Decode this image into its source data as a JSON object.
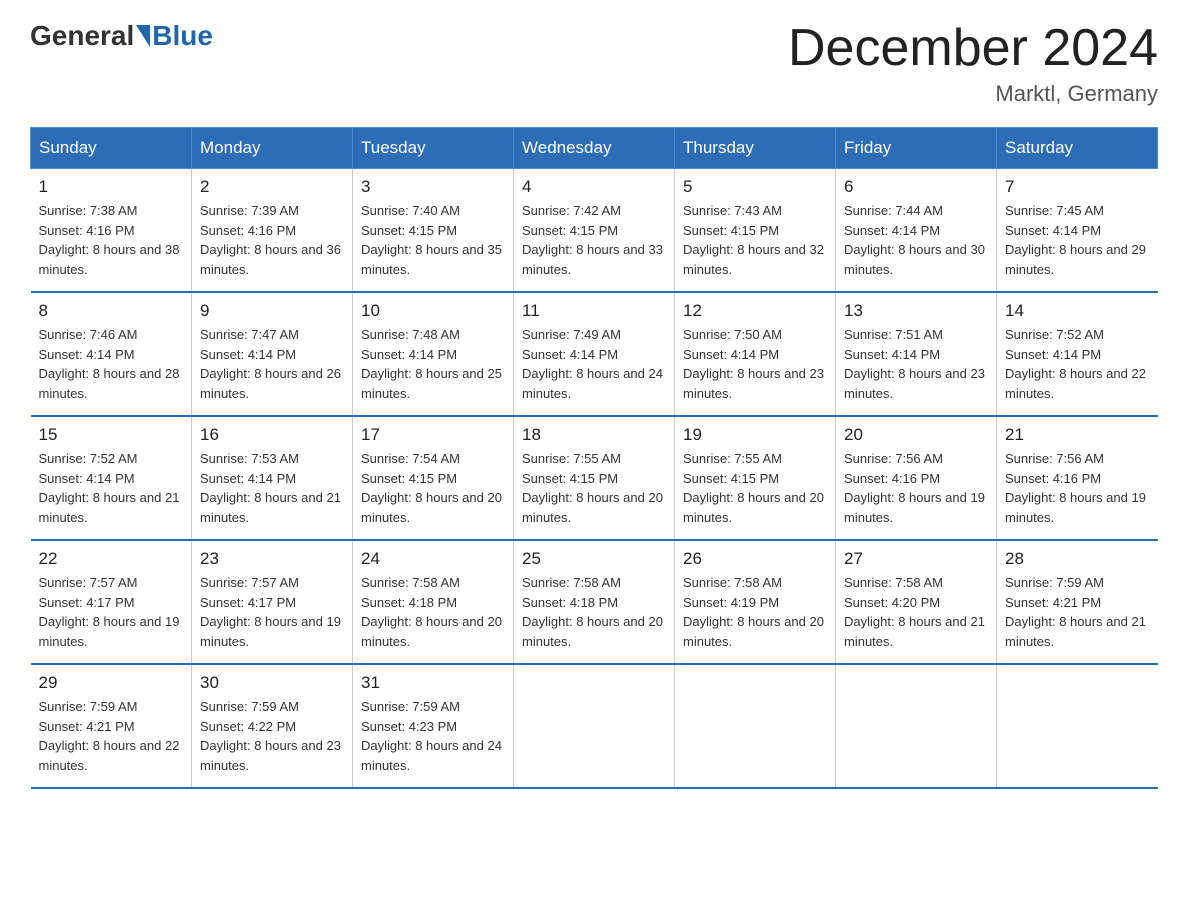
{
  "header": {
    "logo_general": "General",
    "logo_blue": "Blue",
    "title": "December 2024",
    "location": "Marktl, Germany"
  },
  "days_of_week": [
    "Sunday",
    "Monday",
    "Tuesday",
    "Wednesday",
    "Thursday",
    "Friday",
    "Saturday"
  ],
  "weeks": [
    [
      {
        "day": "1",
        "sunrise": "7:38 AM",
        "sunset": "4:16 PM",
        "daylight": "8 hours and 38 minutes."
      },
      {
        "day": "2",
        "sunrise": "7:39 AM",
        "sunset": "4:16 PM",
        "daylight": "8 hours and 36 minutes."
      },
      {
        "day": "3",
        "sunrise": "7:40 AM",
        "sunset": "4:15 PM",
        "daylight": "8 hours and 35 minutes."
      },
      {
        "day": "4",
        "sunrise": "7:42 AM",
        "sunset": "4:15 PM",
        "daylight": "8 hours and 33 minutes."
      },
      {
        "day": "5",
        "sunrise": "7:43 AM",
        "sunset": "4:15 PM",
        "daylight": "8 hours and 32 minutes."
      },
      {
        "day": "6",
        "sunrise": "7:44 AM",
        "sunset": "4:14 PM",
        "daylight": "8 hours and 30 minutes."
      },
      {
        "day": "7",
        "sunrise": "7:45 AM",
        "sunset": "4:14 PM",
        "daylight": "8 hours and 29 minutes."
      }
    ],
    [
      {
        "day": "8",
        "sunrise": "7:46 AM",
        "sunset": "4:14 PM",
        "daylight": "8 hours and 28 minutes."
      },
      {
        "day": "9",
        "sunrise": "7:47 AM",
        "sunset": "4:14 PM",
        "daylight": "8 hours and 26 minutes."
      },
      {
        "day": "10",
        "sunrise": "7:48 AM",
        "sunset": "4:14 PM",
        "daylight": "8 hours and 25 minutes."
      },
      {
        "day": "11",
        "sunrise": "7:49 AM",
        "sunset": "4:14 PM",
        "daylight": "8 hours and 24 minutes."
      },
      {
        "day": "12",
        "sunrise": "7:50 AM",
        "sunset": "4:14 PM",
        "daylight": "8 hours and 23 minutes."
      },
      {
        "day": "13",
        "sunrise": "7:51 AM",
        "sunset": "4:14 PM",
        "daylight": "8 hours and 23 minutes."
      },
      {
        "day": "14",
        "sunrise": "7:52 AM",
        "sunset": "4:14 PM",
        "daylight": "8 hours and 22 minutes."
      }
    ],
    [
      {
        "day": "15",
        "sunrise": "7:52 AM",
        "sunset": "4:14 PM",
        "daylight": "8 hours and 21 minutes."
      },
      {
        "day": "16",
        "sunrise": "7:53 AM",
        "sunset": "4:14 PM",
        "daylight": "8 hours and 21 minutes."
      },
      {
        "day": "17",
        "sunrise": "7:54 AM",
        "sunset": "4:15 PM",
        "daylight": "8 hours and 20 minutes."
      },
      {
        "day": "18",
        "sunrise": "7:55 AM",
        "sunset": "4:15 PM",
        "daylight": "8 hours and 20 minutes."
      },
      {
        "day": "19",
        "sunrise": "7:55 AM",
        "sunset": "4:15 PM",
        "daylight": "8 hours and 20 minutes."
      },
      {
        "day": "20",
        "sunrise": "7:56 AM",
        "sunset": "4:16 PM",
        "daylight": "8 hours and 19 minutes."
      },
      {
        "day": "21",
        "sunrise": "7:56 AM",
        "sunset": "4:16 PM",
        "daylight": "8 hours and 19 minutes."
      }
    ],
    [
      {
        "day": "22",
        "sunrise": "7:57 AM",
        "sunset": "4:17 PM",
        "daylight": "8 hours and 19 minutes."
      },
      {
        "day": "23",
        "sunrise": "7:57 AM",
        "sunset": "4:17 PM",
        "daylight": "8 hours and 19 minutes."
      },
      {
        "day": "24",
        "sunrise": "7:58 AM",
        "sunset": "4:18 PM",
        "daylight": "8 hours and 20 minutes."
      },
      {
        "day": "25",
        "sunrise": "7:58 AM",
        "sunset": "4:18 PM",
        "daylight": "8 hours and 20 minutes."
      },
      {
        "day": "26",
        "sunrise": "7:58 AM",
        "sunset": "4:19 PM",
        "daylight": "8 hours and 20 minutes."
      },
      {
        "day": "27",
        "sunrise": "7:58 AM",
        "sunset": "4:20 PM",
        "daylight": "8 hours and 21 minutes."
      },
      {
        "day": "28",
        "sunrise": "7:59 AM",
        "sunset": "4:21 PM",
        "daylight": "8 hours and 21 minutes."
      }
    ],
    [
      {
        "day": "29",
        "sunrise": "7:59 AM",
        "sunset": "4:21 PM",
        "daylight": "8 hours and 22 minutes."
      },
      {
        "day": "30",
        "sunrise": "7:59 AM",
        "sunset": "4:22 PM",
        "daylight": "8 hours and 23 minutes."
      },
      {
        "day": "31",
        "sunrise": "7:59 AM",
        "sunset": "4:23 PM",
        "daylight": "8 hours and 24 minutes."
      },
      null,
      null,
      null,
      null
    ]
  ]
}
